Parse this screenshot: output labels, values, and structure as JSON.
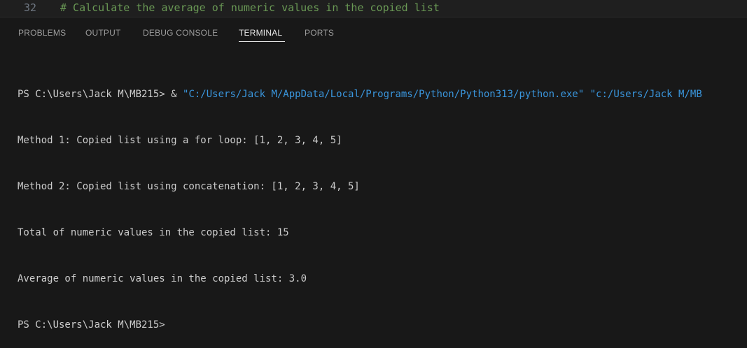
{
  "editor": {
    "line_number": "32",
    "code_comment": "# Calculate the average of numeric values in the copied list"
  },
  "panel_tabs": [
    {
      "label": "PROBLEMS"
    },
    {
      "label": "OUTPUT"
    },
    {
      "label": "DEBUG CONSOLE"
    },
    {
      "label": "TERMINAL",
      "active": true
    },
    {
      "label": "PORTS"
    }
  ],
  "terminal": {
    "prompt": "PS C:\\Users\\Jack M\\MB215>",
    "command_operator": " & ",
    "python_path": "\"C:/Users/Jack M/AppData/Local/Programs/Python/Python313/python.exe\"",
    "script_path": " \"c:/Users/Jack M/MB",
    "output_lines": [
      "Method 1: Copied list using a for loop: [1, 2, 3, 4, 5]",
      "Method 2: Copied list using concatenation: [1, 2, 3, 4, 5]",
      "Total of numeric values in the copied list: 15",
      "Average of numeric values in the copied list: 3.0"
    ],
    "final_prompt": "PS C:\\Users\\Jack M\\MB215>"
  },
  "colors": {
    "background": "#181818",
    "comment": "#6a9955",
    "string": "#3a96dd",
    "text": "#cccccc"
  }
}
